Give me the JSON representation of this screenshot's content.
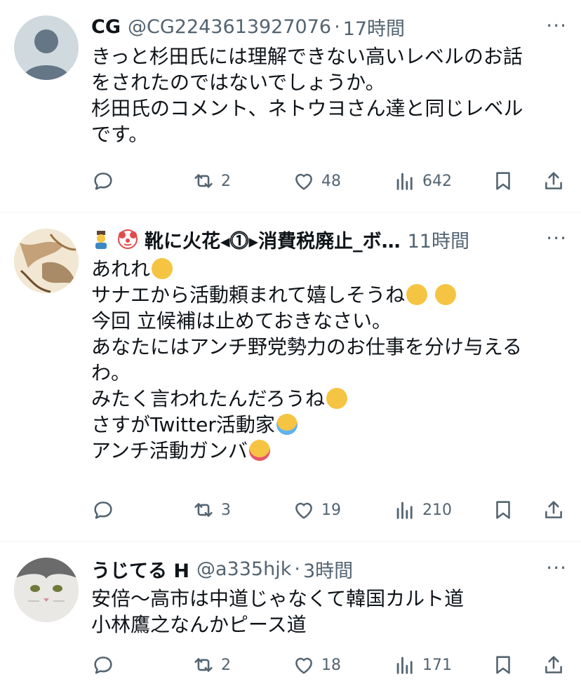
{
  "tweets": [
    {
      "name": "CG",
      "handle": "@CG2243613927076",
      "separator": "·",
      "time": "17時間",
      "more": "···",
      "lines": [
        "きっと杉田氏には理解できない高いレベルのお話",
        "をされたのではないでしょうか。",
        "杉田氏のコメント、ネトウヨさん達と同じレベル",
        "です。"
      ],
      "replies": "",
      "retweets": "2",
      "likes": "48",
      "views": "642"
    },
    {
      "name_prefix_emoji": [
        "crown-person-emoji",
        "clown-emoji"
      ],
      "name": "靴に火花◂⓵▸消費税廃止_ボ…",
      "separator": "",
      "time": "11時間",
      "more": "···",
      "lines": [
        "あれれ",
        "サナエから活動頼まれて嬉しそうね",
        "今回 立候補は止めておきなさい。",
        "あなたにはアンチ野党勢力のお仕事を分け与える",
        "わ。",
        "みたく言われたんだろうね",
        "さすがTwitter活動家",
        "アンチ活動ガンバ"
      ],
      "line_emojis": [
        [
          "smirk-emoji"
        ],
        [
          "smirk-emoji",
          "smirk-emoji"
        ],
        [],
        [],
        [],
        [
          "relieved-emoji"
        ],
        [
          "tears-of-joy-emoji"
        ],
        [
          "zany-face-emoji"
        ]
      ],
      "replies": "",
      "retweets": "3",
      "likes": "19",
      "views": "210"
    },
    {
      "name": "うじてる H",
      "handle": "@a335hjk",
      "separator": "·",
      "time": "3時間",
      "more": "···",
      "lines": [
        "安倍〜高市は中道じゃなくて韓国カルト道",
        "小林鷹之なんかピース道"
      ],
      "replies": "",
      "retweets": "2",
      "likes": "18",
      "views": "171"
    }
  ],
  "colors": {
    "text": "#0f1419",
    "secondary": "#536471",
    "divider": "#eff3f4",
    "emoji_yellow": "#f6c443"
  }
}
